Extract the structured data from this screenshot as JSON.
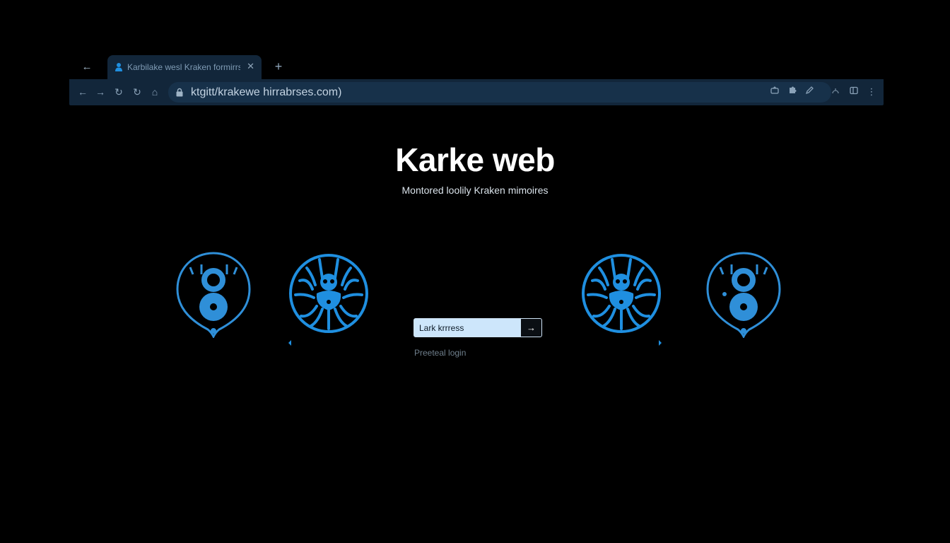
{
  "browser": {
    "tab": {
      "title": "Karbilake wesl Kraken formirrs",
      "favicon": "user-icon"
    },
    "toolbar": {
      "url": "ktgitt/krakewe hirrabrses.com)",
      "icons_left": [
        "back-arrow-icon",
        "forward-arrow-icon",
        "reload-icon",
        "reload-icon",
        "home-icon"
      ],
      "icons_right": [
        "extension-icon",
        "puzzle-icon",
        "pen-icon",
        "profile-icon",
        "sidebar-icon",
        "kebab-menu-icon"
      ]
    }
  },
  "hero": {
    "title": "Karke web",
    "subtitle": "Montored loolily Kraken mimoires"
  },
  "emblems": [
    "keyhole-emblem",
    "kraken-emblem",
    "kraken-emblem",
    "keyhole-emblem"
  ],
  "login": {
    "input_value": "Lark krrress",
    "submit_icon": "arrow-right-icon",
    "link": "Preeteal login"
  },
  "colors": {
    "background": "#000000",
    "chrome": "#12263a",
    "accent": "#1f8fe0",
    "input_bg": "#cde6fb"
  }
}
